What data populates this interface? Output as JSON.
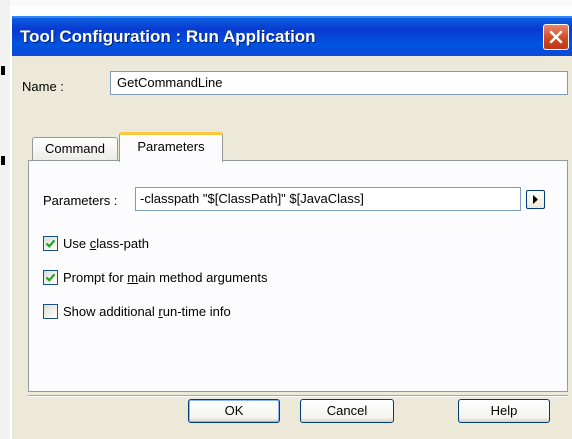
{
  "window": {
    "title": "Tool Configuration : Run Application",
    "close_icon": "close-icon"
  },
  "name_field": {
    "label": "Name :",
    "value": "GetCommandLine"
  },
  "tabs": [
    {
      "label": "Command",
      "selected": false
    },
    {
      "label": "Parameters",
      "selected": true
    }
  ],
  "parameters": {
    "label": "Parameters :",
    "value": "-classpath \"$[ClassPath]\" $[JavaClass]",
    "menu_icon": "triangle-right-icon"
  },
  "options": [
    {
      "label_pre": "Use ",
      "label_accel": "c",
      "label_post": "lass-path",
      "checked": true
    },
    {
      "label_pre": "Prompt for ",
      "label_accel": "m",
      "label_post": "ain method arguments",
      "checked": true
    },
    {
      "label_pre": "Show additional ",
      "label_accel": "r",
      "label_post": "un-time info",
      "checked": false
    }
  ],
  "buttons": {
    "ok": "OK",
    "cancel": "Cancel",
    "help": "Help"
  },
  "colors": {
    "title_bar": "#0a4ad6",
    "dialog_bg": "#ece9d8",
    "tab_highlight": "#ffc83c",
    "check_mark": "#21a121",
    "close_button": "#d2451f"
  }
}
